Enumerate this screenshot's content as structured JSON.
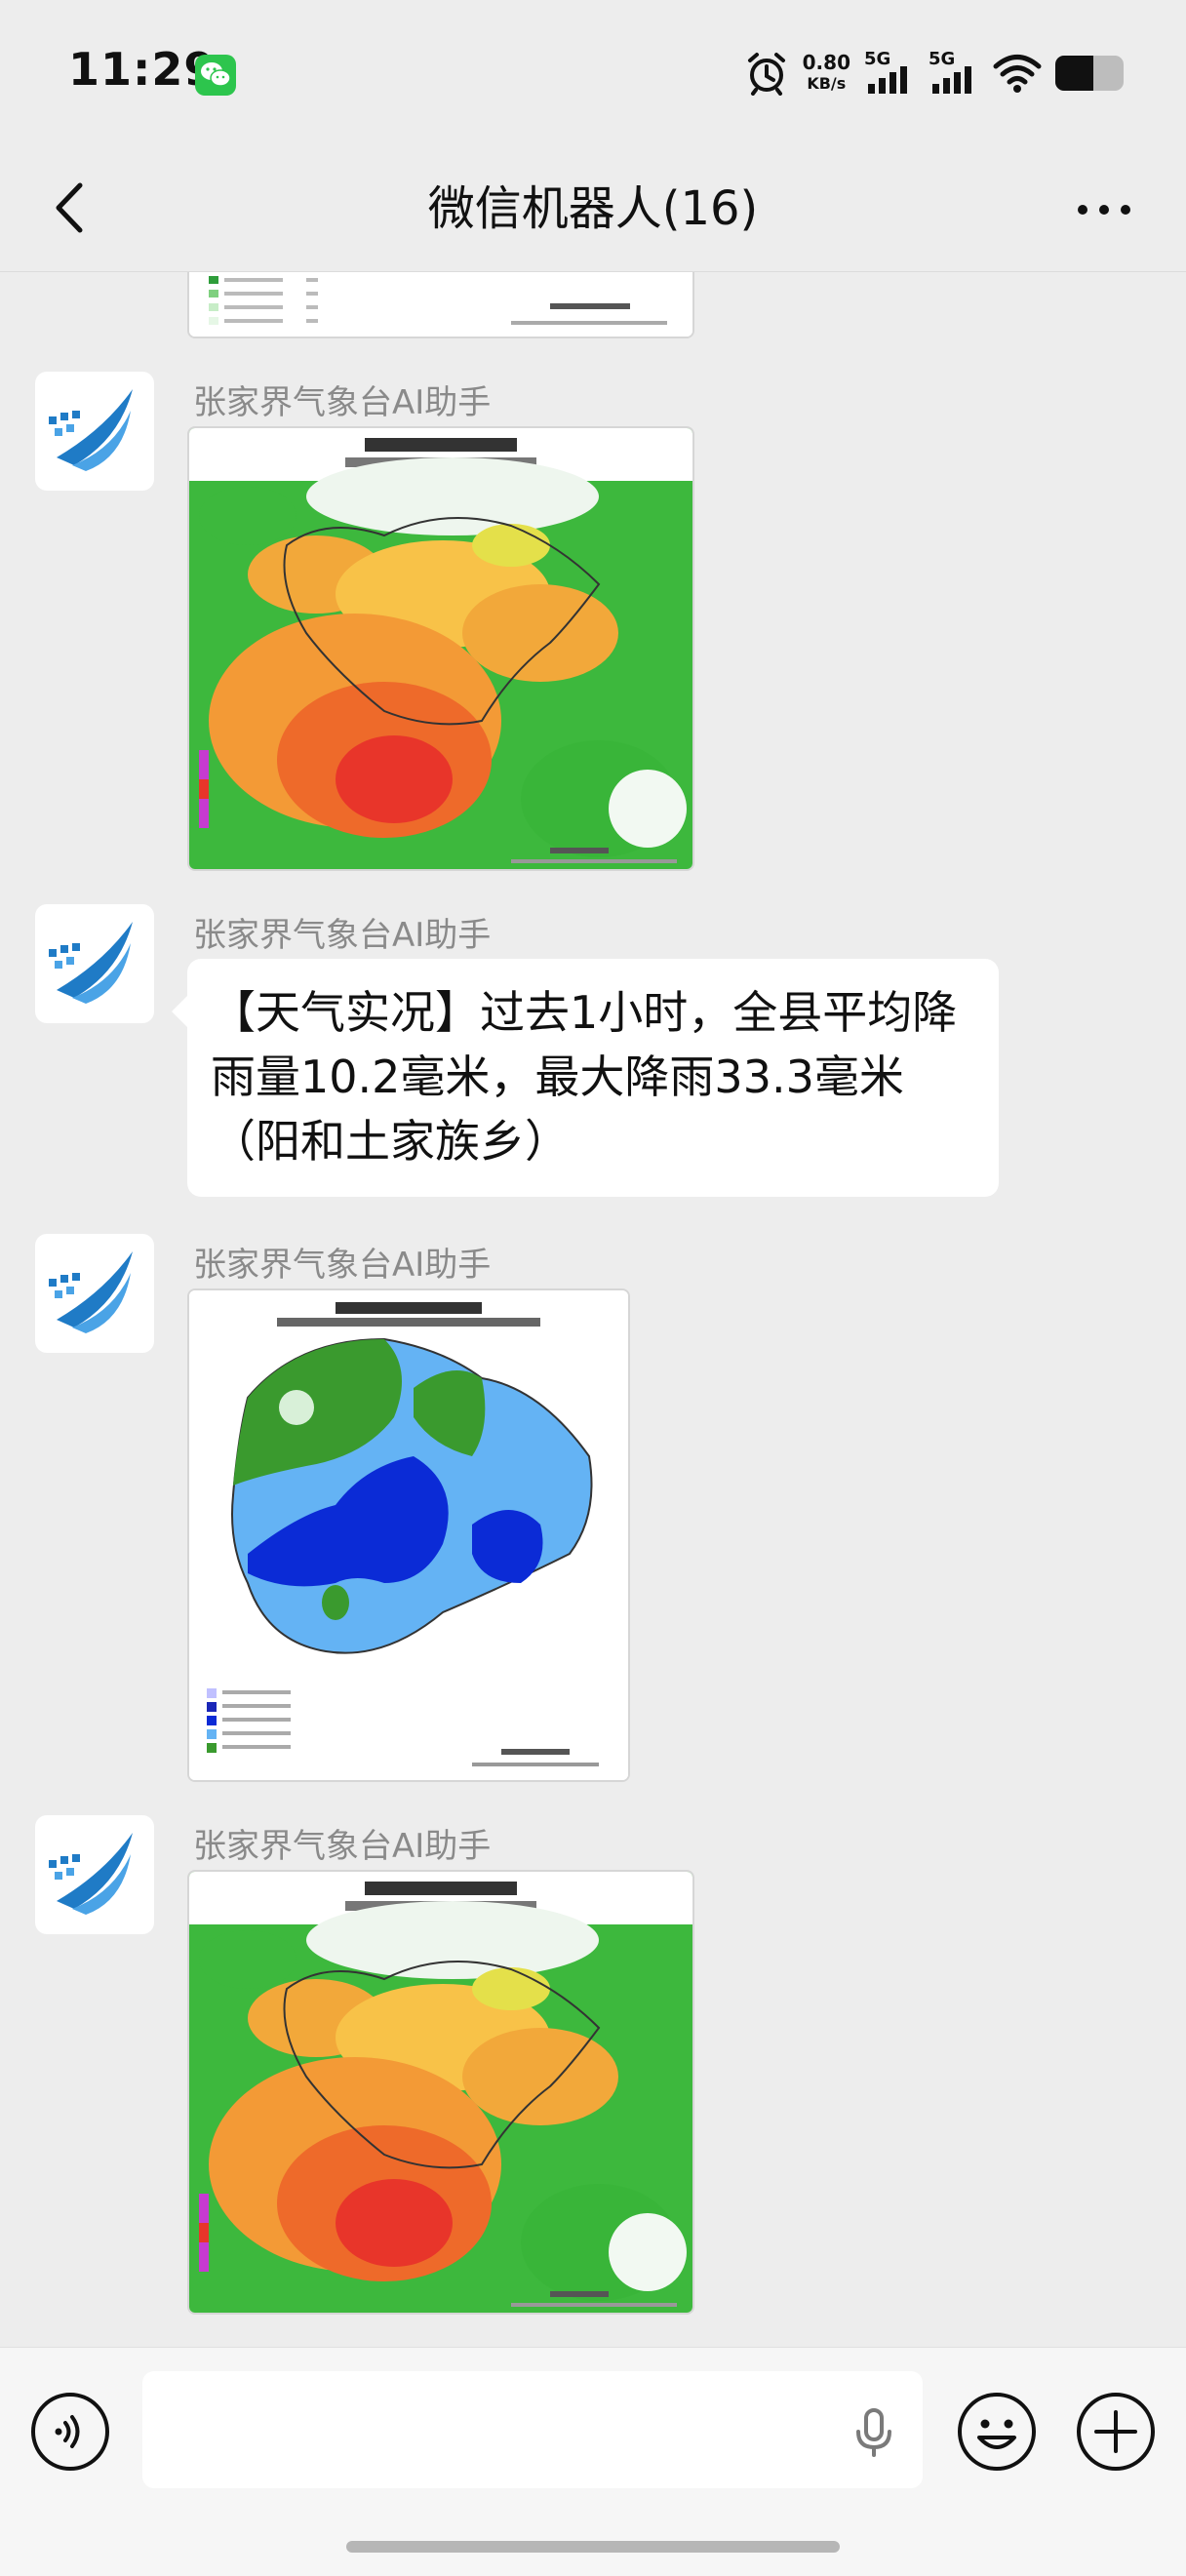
{
  "status_bar": {
    "time": "11:29",
    "net_speed_value": "0.80",
    "net_speed_unit": "KB/s",
    "signal_1": "5G",
    "signal_2": "5G",
    "battery_level": 0.55
  },
  "header": {
    "title": "微信机器人(16)"
  },
  "messages": [
    {
      "sender": "张家界气象台AI助手"
    },
    {
      "sender": "张家界气象台AI助手",
      "text": "【天气实况】过去1小时，全县平均降雨量10.2毫米，最大降雨33.3毫米（阳和土家族乡）"
    },
    {
      "sender": "张家界气象台AI助手"
    },
    {
      "sender": "张家界气象台AI助手"
    }
  ],
  "input": {
    "placeholder": ""
  },
  "colors": {
    "background": "#ededed",
    "bubble": "#ffffff",
    "accent": "#2dc54d",
    "sender_text": "#8a8a8a",
    "avatar_blue": "#1f7bc6"
  },
  "icons": [
    "back-arrow-icon",
    "more-icon",
    "voice-mode-icon",
    "microphone-icon",
    "emoji-icon",
    "plus-icon",
    "alarm-icon",
    "wifi-icon",
    "signal-icon",
    "battery-icon",
    "wechat-icon"
  ]
}
